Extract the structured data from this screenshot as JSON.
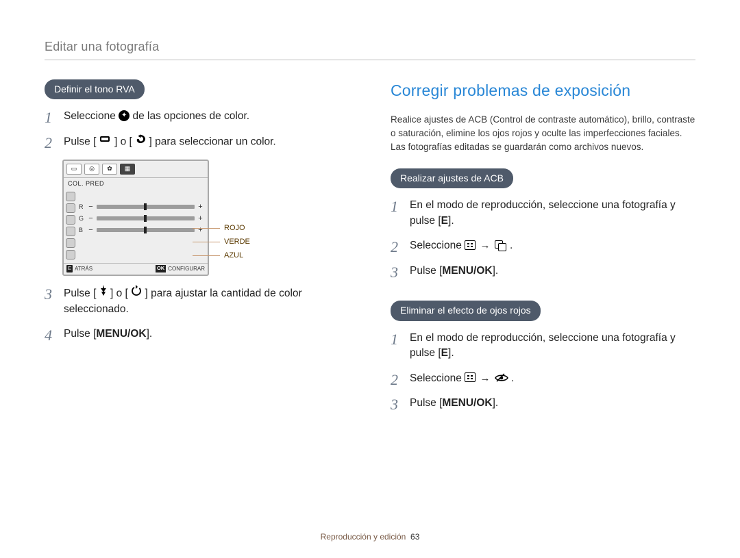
{
  "header": "Editar una fotografía",
  "left": {
    "pill": "Definir el tono RVA",
    "step1_a": "Seleccione ",
    "step1_b": " de las opciones de color.",
    "step2_a": "Pulse [",
    "step2_b": "] o [",
    "step2_c": "] para seleccionar un color.",
    "step3": "Pulse [",
    "step3_b": "] o [",
    "step3_c": "] para ajustar la cantidad de color seleccionado.",
    "step4_a": "Pulse [",
    "step4_key": "MENU/OK",
    "step4_b": "].",
    "lcd": {
      "collabel": "COL. PRED",
      "rgb": {
        "r": "R",
        "g": "G",
        "b": "B"
      },
      "back_key": "E",
      "back": "ATRÁS",
      "ok_key": "OK",
      "ok": "CONFIGURAR"
    },
    "callouts": {
      "r": "ROJO",
      "g": "VERDE",
      "b": "AZUL"
    }
  },
  "right": {
    "title": "Corregir problemas de exposición",
    "intro": "Realice ajustes de ACB (Control de contraste automático), brillo, contraste o saturación, elimine los ojos rojos y oculte las imperfecciones faciales. Las fotografías editadas se guardarán como archivos nuevos.",
    "acb": {
      "pill": "Realizar ajustes de ACB",
      "s1_a": "En el modo de reproducción, seleccione una fotografía y pulse [",
      "s1_key": "E",
      "s1_b": "].",
      "s2_a": "Seleccione ",
      "s2_arrow": " → ",
      "s2_b": ".",
      "s3_a": "Pulse [",
      "s3_key": "MENU/OK",
      "s3_b": "]."
    },
    "redeye": {
      "pill": "Eliminar el efecto de ojos rojos",
      "s1_a": "En el modo de reproducción, seleccione una fotografía y pulse [",
      "s1_key": "E",
      "s1_b": "].",
      "s2_a": "Seleccione ",
      "s2_arrow": " → ",
      "s2_b": ".",
      "s3_a": "Pulse [",
      "s3_key": "MENU/OK",
      "s3_b": "]."
    }
  },
  "footer": {
    "label": "Reproducción y edición",
    "page": "63"
  }
}
